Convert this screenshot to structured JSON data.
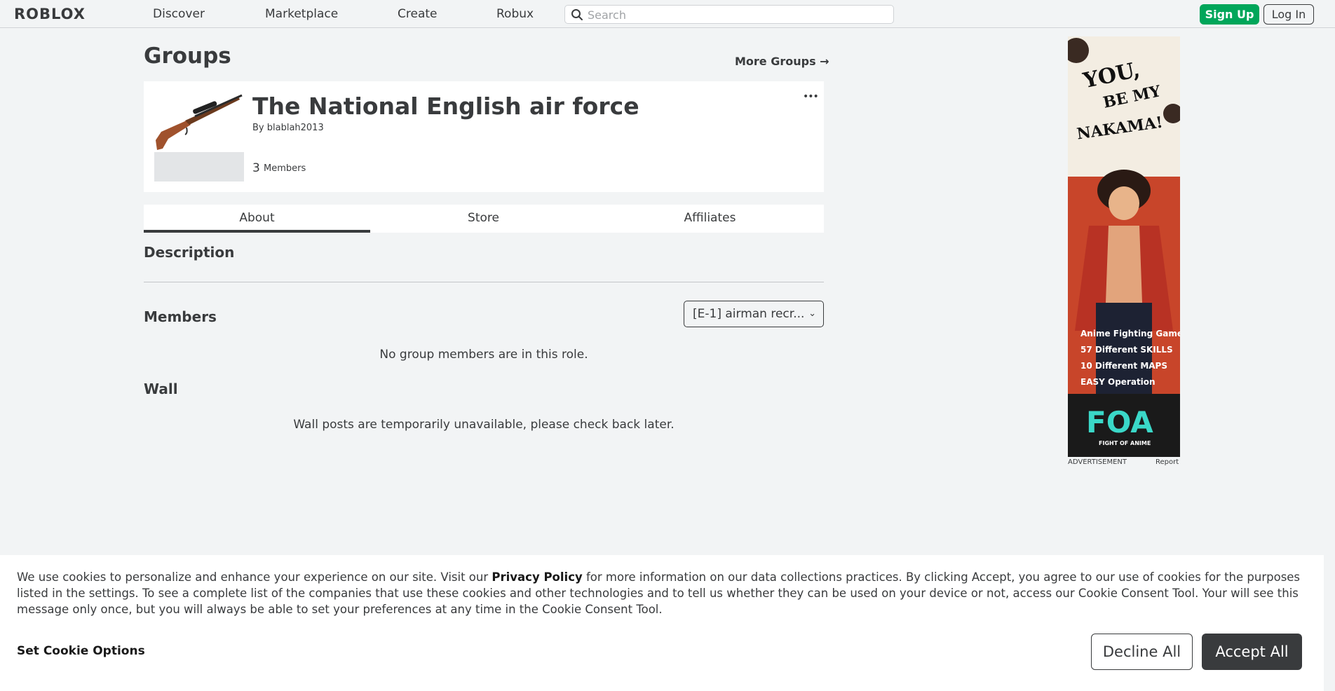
{
  "header": {
    "logo": "ROBLOX",
    "nav": [
      "Discover",
      "Marketplace",
      "Create",
      "Robux"
    ],
    "search_placeholder": "Search",
    "signup_label": "Sign Up",
    "login_label": "Log In"
  },
  "page": {
    "title": "Groups",
    "more_groups": "More Groups →"
  },
  "group": {
    "name": "The National English air force",
    "owner": "By blablah2013",
    "member_count": "3",
    "member_label": "Members",
    "menu": "•••"
  },
  "tabs": [
    "About",
    "Store",
    "Affiliates"
  ],
  "about": {
    "description_title": "Description",
    "members_title": "Members",
    "role_selected": "[E-1] airman recr...",
    "members_empty": "No group members are in this role.",
    "wall_title": "Wall",
    "wall_empty": "Wall posts are temporarily unavailable, please check back later."
  },
  "ad": {
    "headline_line1": "YOU,",
    "headline_line2": "BE MY",
    "headline_line3": "NAKAMA!",
    "feature_1": "Anime Fighting Game",
    "feature_2": "57 Different SKILLS",
    "feature_3": "10 Different MAPS",
    "feature_4": "EASY Operation",
    "brand": "FOA",
    "brand_sub": "FIGHT OF ANIME",
    "label": "ADVERTISEMENT",
    "report": "Report"
  },
  "cookie": {
    "text_before": "We use cookies to personalize and enhance your experience on our site. Visit our ",
    "privacy_link": "Privacy Policy",
    "text_after": " for more information on our data collections practices. By clicking Accept, you agree to our use of cookies for the purposes listed in the settings. To see a complete list of the companies that use these cookies and other technologies and to tell us whether they can be used on your device or not, access our Cookie Consent Tool. Your will see this message only once, but you will always be able to set your preferences at any time in the Cookie Consent Tool.",
    "options_label": "Set Cookie Options",
    "decline_label": "Decline All",
    "accept_label": "Accept All"
  },
  "colors": {
    "signup": "#00a65a",
    "text": "#393b3d",
    "background": "#f2f4f5"
  }
}
